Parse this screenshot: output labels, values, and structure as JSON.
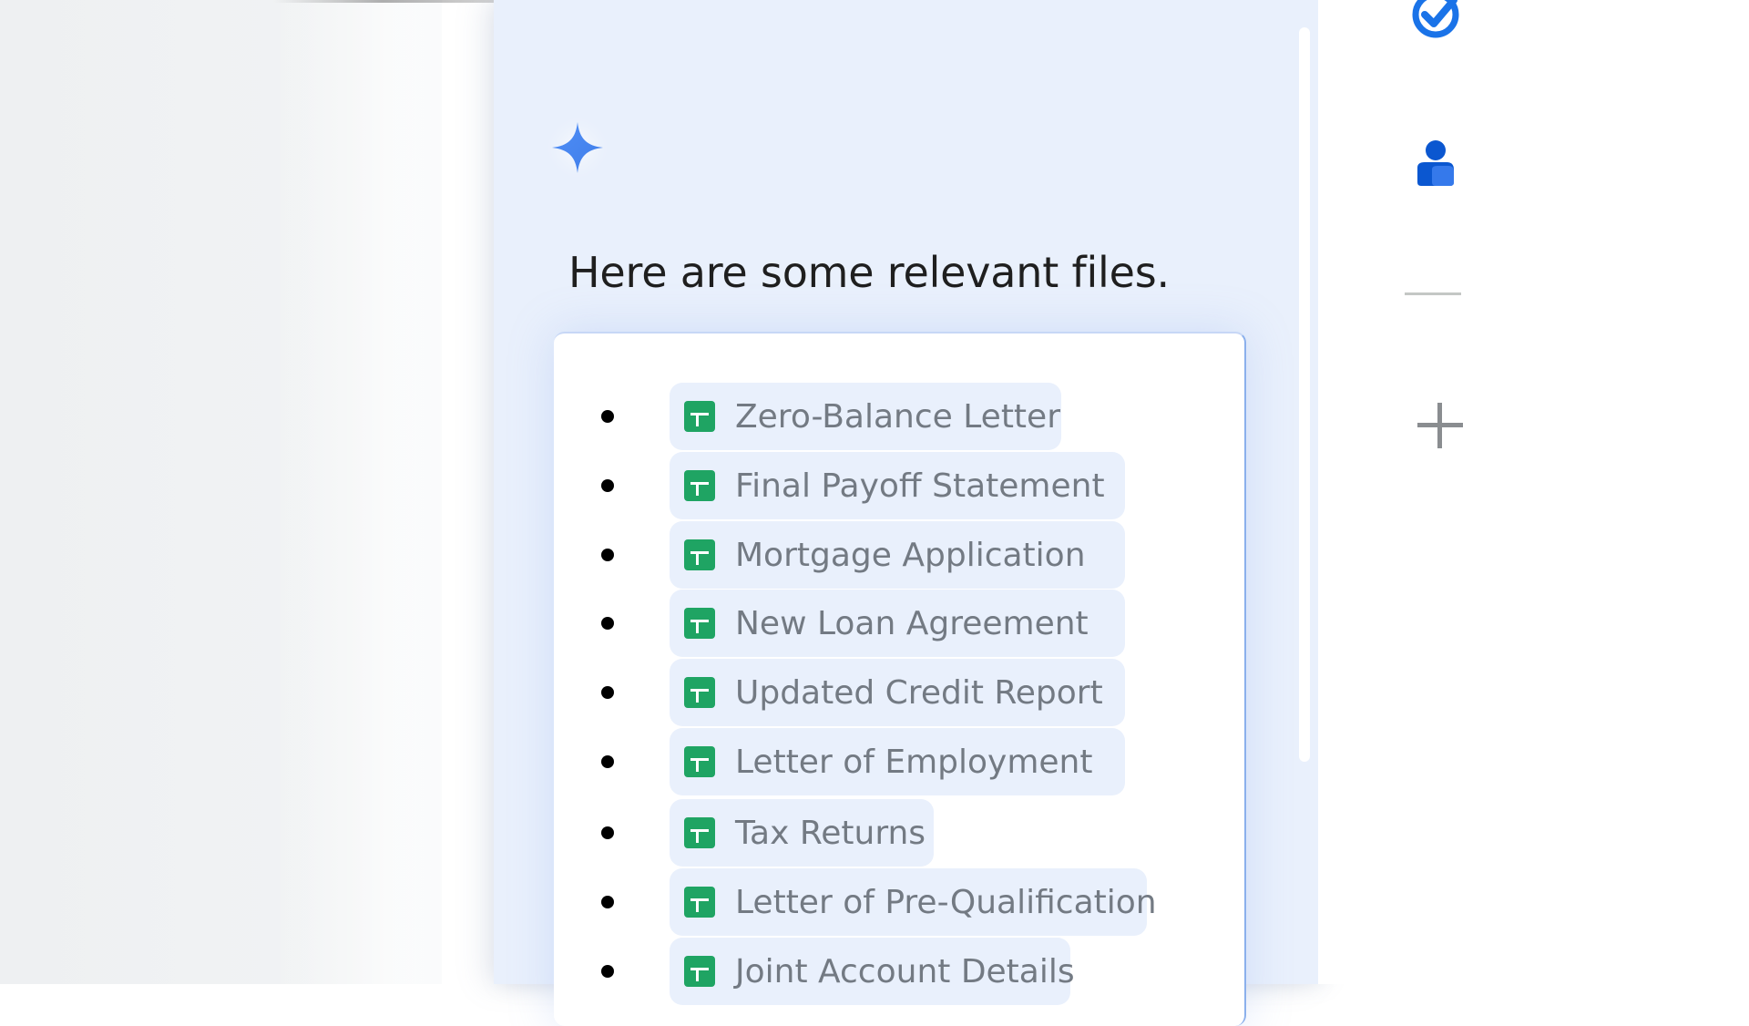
{
  "response": {
    "heading": "Here are some relevant files."
  },
  "files": [
    {
      "name": "Zero-Balance Letter",
      "icon": "sheets-icon"
    },
    {
      "name": "Final Payoff Statement",
      "icon": "sheets-icon"
    },
    {
      "name": "Mortgage Application",
      "icon": "sheets-icon"
    },
    {
      "name": "New Loan Agreement",
      "icon": "sheets-icon"
    },
    {
      "name": "Updated Credit Report",
      "icon": "sheets-icon"
    },
    {
      "name": "Letter of Employment",
      "icon": "sheets-icon"
    },
    {
      "name": "Tax Returns",
      "icon": "sheets-icon"
    },
    {
      "name": "Letter of Pre-Qualification",
      "icon": "sheets-icon"
    },
    {
      "name": "Joint Account Details",
      "icon": "sheets-icon"
    }
  ],
  "side_rail": {
    "icons": [
      "tasks-icon",
      "contacts-icon",
      "divider",
      "add-icon"
    ]
  },
  "colors": {
    "panel_bg": "#e9f0fc",
    "chip_bg": "#e9f0fc",
    "sheets_green": "#1fa463",
    "gemini_blue": "#4285f4",
    "tasks_blue": "#1a73e8",
    "contacts_blue": "#0b57d0"
  }
}
